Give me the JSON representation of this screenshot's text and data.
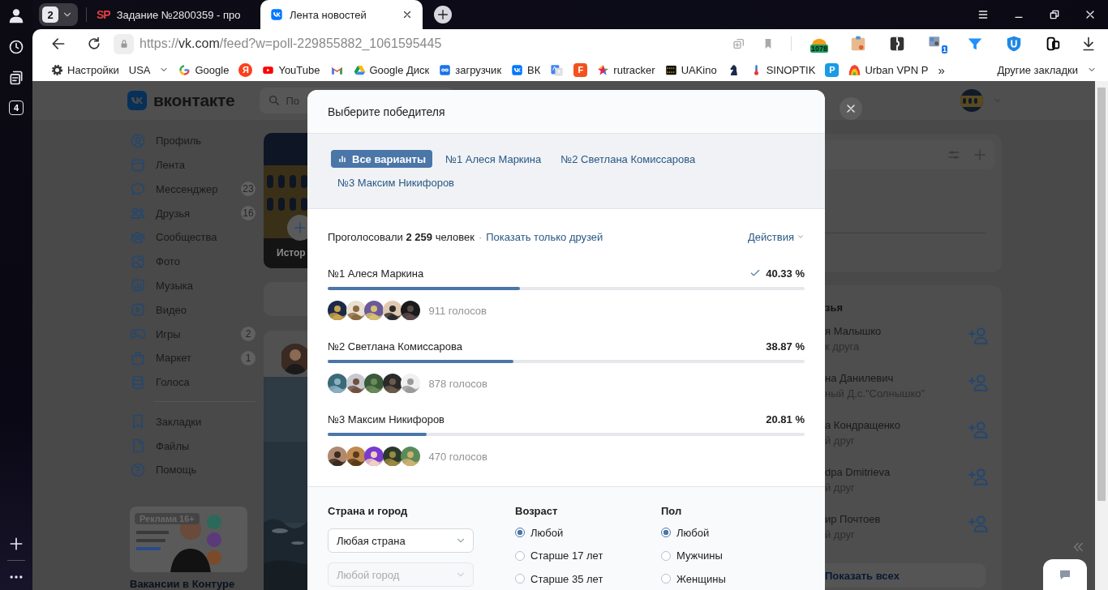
{
  "browser": {
    "tab_counter": "2",
    "tabs": [
      {
        "favicon": "SP",
        "title": "Задание №2800359 - про",
        "selected": false
      },
      {
        "title": "Лента новостей",
        "selected": true
      }
    ],
    "sidebar_badge": "4",
    "url": {
      "scheme": "https://",
      "host": "vk.com",
      "path": "/feed?w=poll-229855882_1061595445"
    },
    "extensions": [
      {
        "kind": "counter",
        "badge": "1078"
      },
      {
        "kind": "plain"
      },
      {
        "kind": "plain"
      },
      {
        "kind": "counter",
        "badge": "1"
      },
      {
        "kind": "plain"
      },
      {
        "kind": "plain"
      },
      {
        "kind": "plain"
      }
    ],
    "bookmarks": [
      {
        "kind": "link",
        "label": "Настройки"
      },
      {
        "kind": "menu",
        "label": "USA"
      },
      {
        "kind": "link",
        "label": "Google"
      },
      {
        "kind": "letter",
        "glyph": "Я"
      },
      {
        "kind": "link",
        "label": "YouTube"
      },
      {
        "kind": "icon"
      },
      {
        "kind": "link",
        "label": "Google Диск"
      },
      {
        "kind": "link",
        "label": "загрузчик"
      },
      {
        "kind": "link",
        "label": "ВК"
      },
      {
        "kind": "icon"
      },
      {
        "kind": "letter",
        "glyph": "F"
      },
      {
        "kind": "link",
        "label": "rutracker"
      },
      {
        "kind": "link",
        "label": "UAKino"
      },
      {
        "kind": "icon"
      },
      {
        "kind": "link",
        "label": "SINOPTIK"
      },
      {
        "kind": "letter",
        "glyph": "P"
      },
      {
        "kind": "link",
        "label": "Urban VPN P"
      }
    ],
    "more": "»",
    "other_bookmarks": "Другие закладки"
  },
  "vk": {
    "logo": "вконтакте",
    "search_placeholder": "По",
    "nav": [
      {
        "label": "Профиль"
      },
      {
        "label": "Лента"
      },
      {
        "label": "Мессенджер",
        "badge": "23"
      },
      {
        "label": "Друзья",
        "badge": "16"
      },
      {
        "label": "Сообщества"
      },
      {
        "label": "Фото"
      },
      {
        "label": "Музыка"
      },
      {
        "label": "Видео"
      },
      {
        "label": "Игры",
        "badge": "2"
      },
      {
        "label": "Маркет",
        "badge": "1"
      },
      {
        "label": "Голоса"
      }
    ],
    "nav_secondary": [
      {
        "label": "Закладки"
      },
      {
        "label": "Файлы"
      },
      {
        "label": "Помощь"
      }
    ],
    "ad": {
      "badge": "Реклама 16+",
      "title": "Вакансии в Контуре"
    },
    "stories_label": "Истор",
    "friends": {
      "heading": "зья",
      "items": [
        {
          "name": "я Малышко",
          "sub": "к друга"
        },
        {
          "name": "на Данилевич",
          "sub": "ный Д.с.\"Солнышко\""
        },
        {
          "name": "а Кондращенко",
          "sub": "й друг"
        },
        {
          "name": "dpa Dmitrieva",
          "sub": "й друг"
        },
        {
          "name": "ир Почтоев",
          "sub": "й друг"
        }
      ],
      "show_all": "Показать всех"
    }
  },
  "poll": {
    "title": "Выберите победителя",
    "tabs": [
      {
        "label": "Все варианты",
        "selected": true
      },
      {
        "label": "№1 Алеся Маркина",
        "selected": false
      },
      {
        "label": "№2 Светлана Комиссарова",
        "selected": false
      },
      {
        "label": "№3 Максим Никифоров",
        "selected": false
      }
    ],
    "summary": "Проголосовали **2 259** человек",
    "separator": "·",
    "friends_link": "Показать только друзей",
    "actions": "Действия",
    "options": [
      {
        "label": "№1 Алеся Маркина",
        "percent": "40.33 %",
        "level": 0.4033,
        "voted": true,
        "votes": "911 голосов",
        "avatars": [
          {
            "kind": "picture"
          },
          {
            "kind": "picture"
          },
          {
            "kind": "picture"
          },
          {
            "kind": "picture"
          },
          {
            "kind": "picture"
          }
        ]
      },
      {
        "label": "№2 Светлана Комиссарова",
        "percent": "38.87 %",
        "level": 0.3887,
        "voted": false,
        "votes": "878 голосов",
        "avatars": [
          {
            "kind": "picture"
          },
          {
            "kind": "picture"
          },
          {
            "kind": "picture"
          },
          {
            "kind": "picture"
          },
          {
            "kind": "picture"
          }
        ]
      },
      {
        "label": "№3 Максим Никифоров",
        "percent": "20.81 %",
        "level": 0.2081,
        "voted": false,
        "votes": "470 голосов",
        "avatars": [
          {
            "kind": "picture"
          },
          {
            "kind": "picture"
          },
          {
            "kind": "picture"
          },
          {
            "kind": "picture"
          },
          {
            "kind": "picture"
          }
        ]
      }
    ],
    "filters": {
      "location": {
        "label": "Страна и город",
        "country": {
          "value": "Любая страна",
          "disabled": false
        },
        "city": {
          "value": "Любой город",
          "disabled": true
        }
      },
      "age": {
        "label": "Возраст",
        "options": [
          {
            "label": "Любой",
            "selected": true
          },
          {
            "label": "Старше 17 лет",
            "selected": false
          },
          {
            "label": "Старше 35 лет",
            "selected": false
          }
        ]
      },
      "sex": {
        "label": "Пол",
        "options": [
          {
            "label": "Любой",
            "selected": true
          },
          {
            "label": "Мужчины",
            "selected": false
          },
          {
            "label": "Женщины",
            "selected": false
          }
        ]
      }
    }
  }
}
